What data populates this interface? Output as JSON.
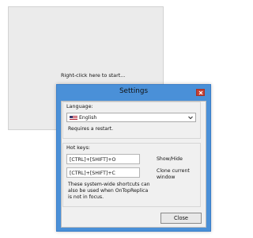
{
  "replica": {
    "start_text": "Right-click here to start..."
  },
  "dialog": {
    "title": "Settings",
    "language_group": {
      "label": "Language:",
      "selected": "English",
      "note": "Requires a restart."
    },
    "hotkeys_group": {
      "label": "Hot keys:",
      "rows": [
        {
          "value": "[CTRL]+[SHIFT]+O",
          "action": "Show/Hide"
        },
        {
          "value": "[CTRL]+[SHIFT]+C",
          "action_line1": "Clone current",
          "action_line2": "window"
        }
      ],
      "note_lines": [
        "These system-wide shortcuts can",
        "also be used when OnTopReplica",
        "is not in focus."
      ]
    },
    "close_label": "Close"
  },
  "colors": {
    "title_bar": "#4a90d8",
    "close_button": "#c64035",
    "replica_bg": "#ebebeb"
  }
}
